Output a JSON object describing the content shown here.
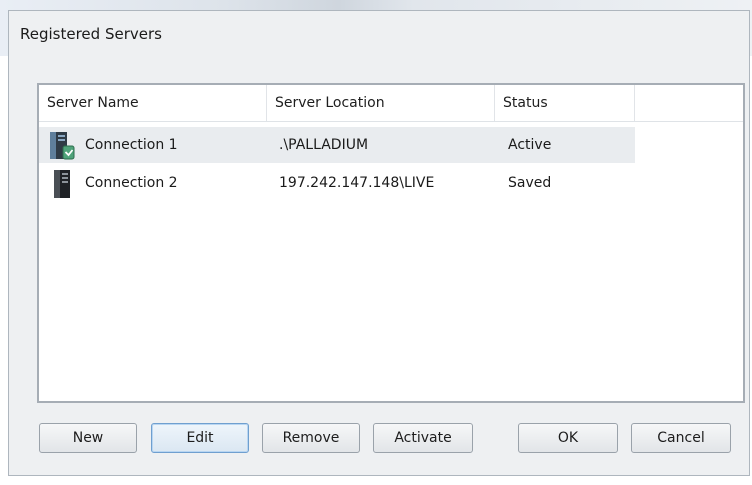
{
  "dialog": {
    "title": "Registered Servers"
  },
  "list": {
    "columns": [
      "Server Name",
      "Server Location",
      "Status"
    ],
    "rows": [
      {
        "name": "Connection 1",
        "location": ".\\PALLADIUM",
        "status": "Active",
        "icon": "server-active-icon",
        "selected": true
      },
      {
        "name": "Connection 2",
        "location": "197.242.147.148\\LIVE",
        "status": "Saved",
        "icon": "server-icon",
        "selected": false
      }
    ]
  },
  "buttons": {
    "new": "New",
    "edit": "Edit",
    "remove": "Remove",
    "activate": "Activate",
    "ok": "OK",
    "cancel": "Cancel"
  },
  "colors": {
    "dialog_bg": "#eef0f2",
    "selected_row": "#e9ecef",
    "focus_border": "#6f9fcf"
  }
}
